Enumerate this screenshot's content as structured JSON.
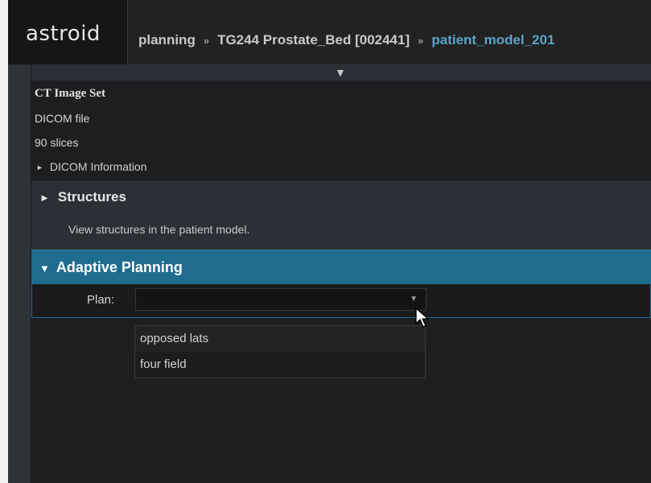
{
  "app": {
    "logo": "astroid"
  },
  "breadcrumb": {
    "items": [
      "planning",
      "TG244 Prostate_Bed [002441]",
      "patient_model_201"
    ],
    "separator": "»"
  },
  "panel": {
    "collapse_glyph": "▼",
    "ct": {
      "title": "CT Image Set",
      "file_type": "DICOM file",
      "slices": "90 slices",
      "dicom_info_label": "DICOM Information"
    },
    "structures": {
      "title": "Structures",
      "description": "View structures in the patient model."
    },
    "adaptive": {
      "title": "Adaptive Planning",
      "plan_label": "Plan:",
      "plan_value": "",
      "options": [
        "opposed lats",
        "four field"
      ]
    }
  },
  "colors": {
    "accent": "#1f6c8f",
    "breadcrumb_current": "#5aa3c8"
  }
}
